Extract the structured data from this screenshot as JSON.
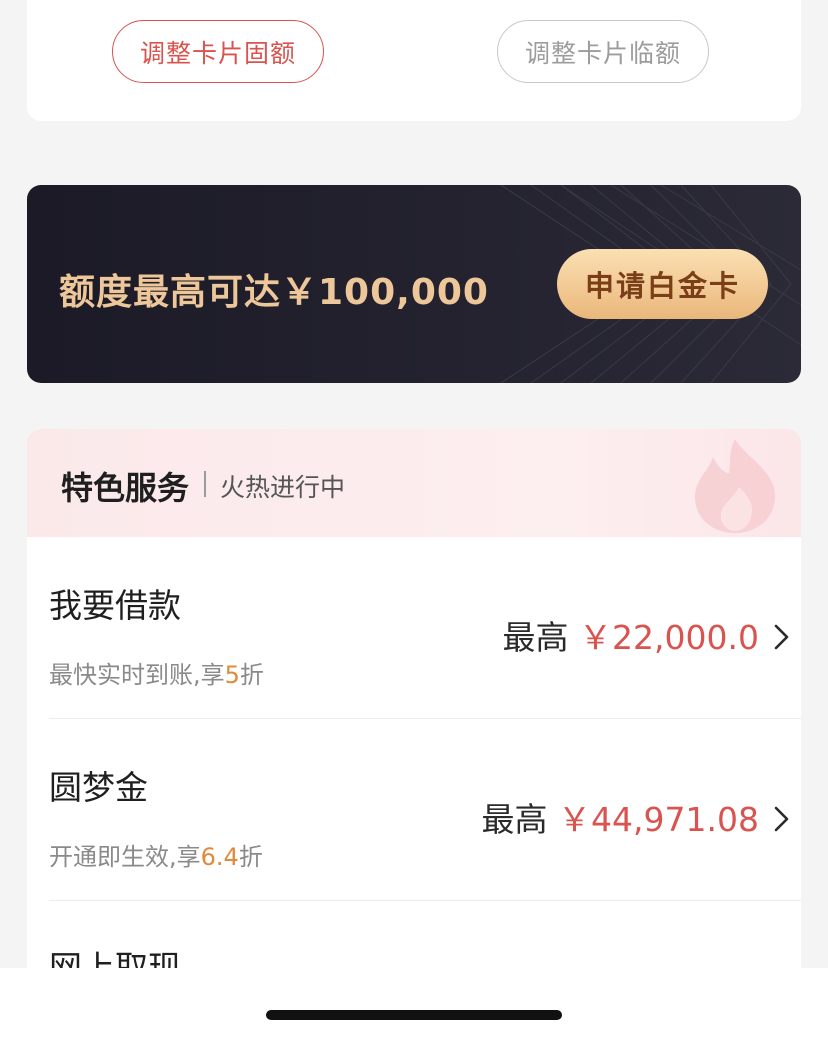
{
  "limit_buttons": {
    "fixed_label": "调整卡片固额",
    "temp_label": "调整卡片临额"
  },
  "promo": {
    "text": "额度最高可达￥100,000",
    "button_label": "申请白金卡"
  },
  "services": {
    "title": "特色服务",
    "subtitle": "火热进行中",
    "items": [
      {
        "name": "我要借款",
        "desc_prefix": "最快实时到账,享",
        "desc_highlight": "5",
        "desc_suffix": "折",
        "amount_label": "最高",
        "amount_value": "￥22,000.0"
      },
      {
        "name": "圆梦金",
        "desc_prefix": "开通即生效,享",
        "desc_highlight": "6.4",
        "desc_suffix": "折",
        "amount_label": "最高",
        "amount_value": "￥44,971.08"
      },
      {
        "name": "网上取现"
      }
    ]
  },
  "colors": {
    "accent_red": "#d9534f",
    "highlight_orange": "#e08b3a",
    "banner_gold": "#edc79a",
    "banner_bg": "#1b1a26"
  },
  "icons": {
    "chevron": "chevron-right-icon",
    "flame": "flame-icon"
  }
}
